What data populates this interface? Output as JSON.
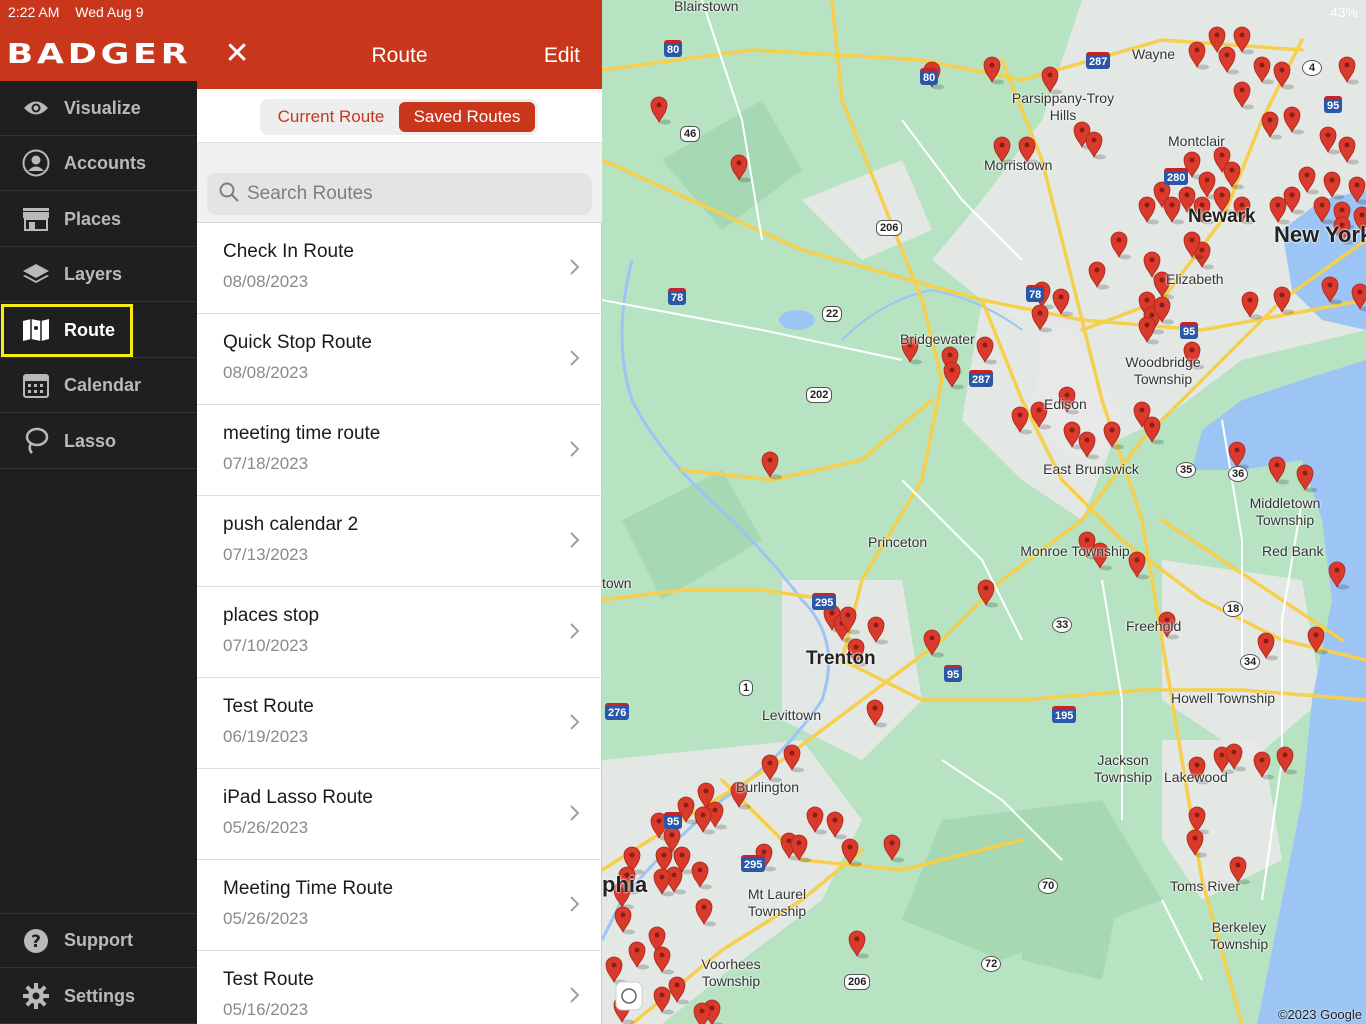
{
  "status_bar": {
    "time": "2:22 AM",
    "date": "Wed Aug 9",
    "battery": "43%"
  },
  "brand": {
    "name": "BADGER"
  },
  "sidebar": {
    "items": [
      {
        "label": "Visualize",
        "icon": "eye-icon"
      },
      {
        "label": "Accounts",
        "icon": "person-icon"
      },
      {
        "label": "Places",
        "icon": "store-icon"
      },
      {
        "label": "Layers",
        "icon": "layers-icon"
      },
      {
        "label": "Route",
        "icon": "map-icon",
        "active": true
      },
      {
        "label": "Calendar",
        "icon": "calendar-icon"
      },
      {
        "label": "Lasso",
        "icon": "lasso-icon"
      }
    ],
    "bottom_items": [
      {
        "label": "Support",
        "icon": "question-icon"
      },
      {
        "label": "Settings",
        "icon": "gear-icon"
      }
    ]
  },
  "panel": {
    "title": "Route",
    "edit_label": "Edit",
    "close_glyph": "✕",
    "tabs": [
      {
        "label": "Current Route",
        "selected": false
      },
      {
        "label": "Saved Routes",
        "selected": true
      }
    ],
    "search_placeholder": "Search Routes",
    "routes": [
      {
        "name": "Check In Route",
        "date": "08/08/2023"
      },
      {
        "name": "Quick Stop Route",
        "date": "08/08/2023"
      },
      {
        "name": "meeting time route",
        "date": "07/18/2023"
      },
      {
        "name": "push calendar 2",
        "date": "07/13/2023"
      },
      {
        "name": "places stop",
        "date": "07/10/2023"
      },
      {
        "name": "Test Route",
        "date": "06/19/2023"
      },
      {
        "name": "iPad Lasso Route",
        "date": "05/26/2023"
      },
      {
        "name": "Meeting Time Route",
        "date": "05/26/2023"
      },
      {
        "name": "Test Route",
        "date": "05/16/2023"
      }
    ]
  },
  "map": {
    "labels": {
      "blairstown": "Blairstown",
      "wayne": "Wayne",
      "parsippany": "Parsippany-Troy Hills",
      "montclair": "Montclair",
      "morristown": "Morristown",
      "newark": "Newark",
      "new_york": "New York",
      "elizabeth": "Elizabeth",
      "bridgewater": "Bridgewater",
      "woodbridge": "Woodbridge Township",
      "edison": "Edison",
      "east_brunswick": "East Brunswick",
      "middletown": "Middletown Township",
      "princeton": "Princeton",
      "red_bank": "Red Bank",
      "monroe": "Monroe Township",
      "trenton": "Trenton",
      "freehold": "Freehold",
      "howell": "Howell Township",
      "levittown": "Levittown",
      "jackson": "Jackson Township",
      "lakewood": "Lakewood",
      "burlington": "Burlington",
      "philadelphia": "phia",
      "mt_laurel": "Mt Laurel Township",
      "toms_river": "Toms River",
      "berkeley": "Berkeley Township",
      "voorhees": "Voorhees Township",
      "town": "town"
    },
    "shields": [
      "80",
      "46",
      "287",
      "4",
      "80",
      "95",
      "280",
      "206",
      "78",
      "22",
      "78",
      "202",
      "287",
      "95",
      "35",
      "36",
      "295",
      "18",
      "33",
      "34",
      "1",
      "95",
      "276",
      "195",
      "95",
      "295",
      "70",
      "72",
      "206"
    ],
    "copyright": "©2023 Google",
    "colors": {
      "water": "#9cc5f5",
      "land_green": "#b8e3c3",
      "urban": "#e8e8e8",
      "highway": "#f6cf4c",
      "pin": "#d93a2b",
      "brand": "#c8361c",
      "highlight": "#f7ea15"
    }
  }
}
